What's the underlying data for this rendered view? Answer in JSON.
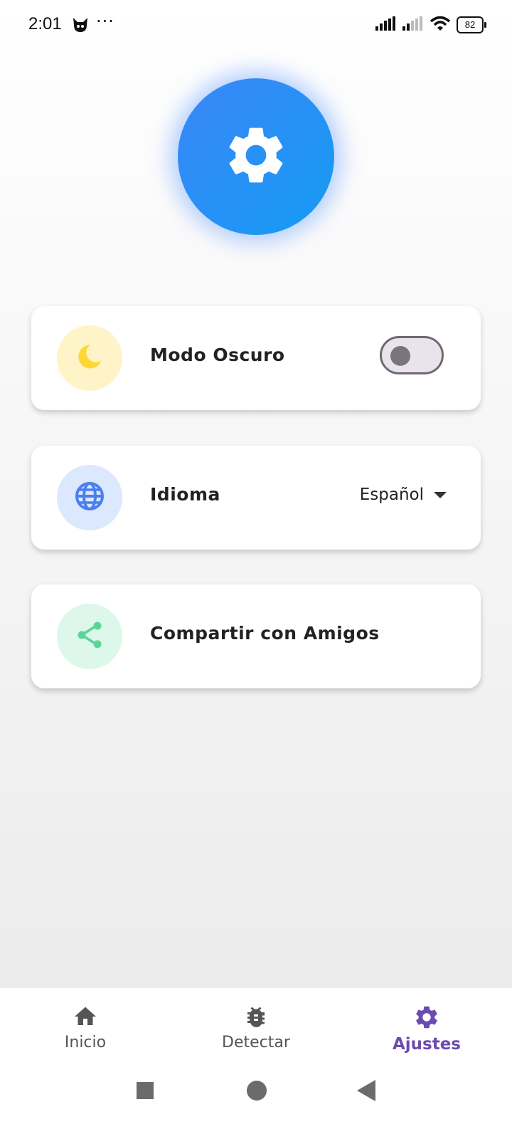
{
  "status_bar": {
    "time": "2:01",
    "dots": "···",
    "battery_level": "82",
    "icons": [
      "cat-notification-icon",
      "signal-icon",
      "signal-icon",
      "wifi-icon",
      "battery-icon"
    ]
  },
  "hero": {
    "icon": "gear-icon",
    "colors": [
      "#3a86f8",
      "#159cf3"
    ]
  },
  "settings": {
    "dark_mode": {
      "label": "Modo Oscuro",
      "icon": "moon-icon",
      "enabled": false,
      "icon_bg": "#fff3c8",
      "icon_color": "#fdd835"
    },
    "language": {
      "label": "Idioma",
      "icon": "globe-icon",
      "value": "Español",
      "icon_bg": "#dbe8fd",
      "icon_color": "#4a7ff0"
    },
    "share": {
      "label": "Compartir con Amigos",
      "icon": "share-icon",
      "icon_bg": "#ddf7ea",
      "icon_color": "#5ad59a"
    }
  },
  "bottom_nav": {
    "items": [
      {
        "label": "Inicio",
        "icon": "home-icon",
        "active": false
      },
      {
        "label": "Detectar",
        "icon": "bug-icon",
        "active": false
      },
      {
        "label": "Ajustes",
        "icon": "gear-icon",
        "active": true
      }
    ],
    "active_color": "#6a4bb0"
  },
  "system_nav": {
    "icons": [
      "recents-square-icon",
      "home-circle-icon",
      "back-triangle-icon"
    ]
  }
}
